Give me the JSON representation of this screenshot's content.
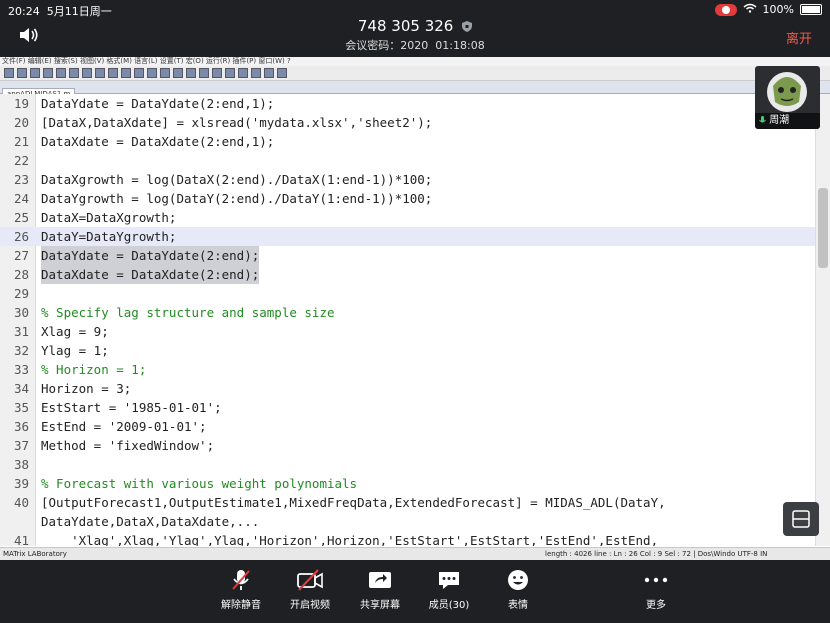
{
  "status": {
    "time": "20:24",
    "date": "5月11日周一",
    "battery": "100%"
  },
  "meeting": {
    "id": "748 305 326",
    "passcode_label": "会议密码：2020",
    "elapsed": "01:18:08",
    "leave_label": "离开"
  },
  "editor": {
    "menu_text": "文件(F)  编辑(E)  搜索(S)  视图(V)  格式(M)  语言(L)  设置(T)  宏(O)  运行(R)  插件(P)  窗口(W)  ?",
    "tab_name": "appADLMIDAS1.m",
    "status_left": "MATrix LABoratory",
    "status_right": "length : 4026   line : Ln : 26   Col : 9   Sel : 72 | Dos\\Windo UTF-8        IN",
    "lines": [
      {
        "n": "19",
        "t": "DataYdate = DataYdate(2:end,1);"
      },
      {
        "n": "20",
        "t": "[DataX,DataXdate] = xlsread('mydata.xlsx','sheet2');"
      },
      {
        "n": "21",
        "t": "DataXdate = DataXdate(2:end,1);"
      },
      {
        "n": "22",
        "t": ""
      },
      {
        "n": "23",
        "t": "DataXgrowth = log(DataX(2:end)./DataX(1:end-1))*100;"
      },
      {
        "n": "24",
        "t": "DataYgrowth = log(DataY(2:end)./DataY(1:end-1))*100;"
      },
      {
        "n": "25",
        "t": "DataX=DataXgrowth;"
      },
      {
        "n": "26",
        "t": "DataY=DataYgrowth;"
      },
      {
        "n": "27",
        "t": "DataYdate = DataYdate(2:end);"
      },
      {
        "n": "28",
        "t": "DataXdate = DataXdate(2:end);"
      },
      {
        "n": "29",
        "t": ""
      },
      {
        "n": "30",
        "t": "% Specify lag structure and sample size"
      },
      {
        "n": "31",
        "t": "Xlag = 9;"
      },
      {
        "n": "32",
        "t": "Ylag = 1;"
      },
      {
        "n": "33",
        "t": "% Horizon = 1;"
      },
      {
        "n": "34",
        "t": "Horizon = 3;"
      },
      {
        "n": "35",
        "t": "EstStart = '1985-01-01';"
      },
      {
        "n": "36",
        "t": "EstEnd = '2009-01-01';"
      },
      {
        "n": "37",
        "t": "Method = 'fixedWindow';"
      },
      {
        "n": "38",
        "t": ""
      },
      {
        "n": "39",
        "t": "% Forecast with various weight polynomials"
      },
      {
        "n": "40",
        "t": "[OutputForecast1,OutputEstimate1,MixedFreqData,ExtendedForecast] = MIDAS_ADL(DataY,"
      },
      {
        "n": "",
        "t": "DataYdate,DataX,DataXdate,..."
      },
      {
        "n": "41",
        "t": "    'Xlag',Xlag,'Ylag',Ylag,'Horizon',Horizon,'EstStart',EstStart,'EstEnd',EstEnd,"
      }
    ]
  },
  "participant": {
    "name": "周潮"
  },
  "controls": [
    {
      "label": "解除静音",
      "icon": "mic-muted-icon"
    },
    {
      "label": "开启视频",
      "icon": "video-off-icon"
    },
    {
      "label": "共享屏幕",
      "icon": "share-screen-icon"
    },
    {
      "label": "成员(30)",
      "icon": "members-icon"
    },
    {
      "label": "表情",
      "icon": "emoji-icon"
    },
    {
      "label": "更多",
      "icon": "more-icon"
    }
  ]
}
